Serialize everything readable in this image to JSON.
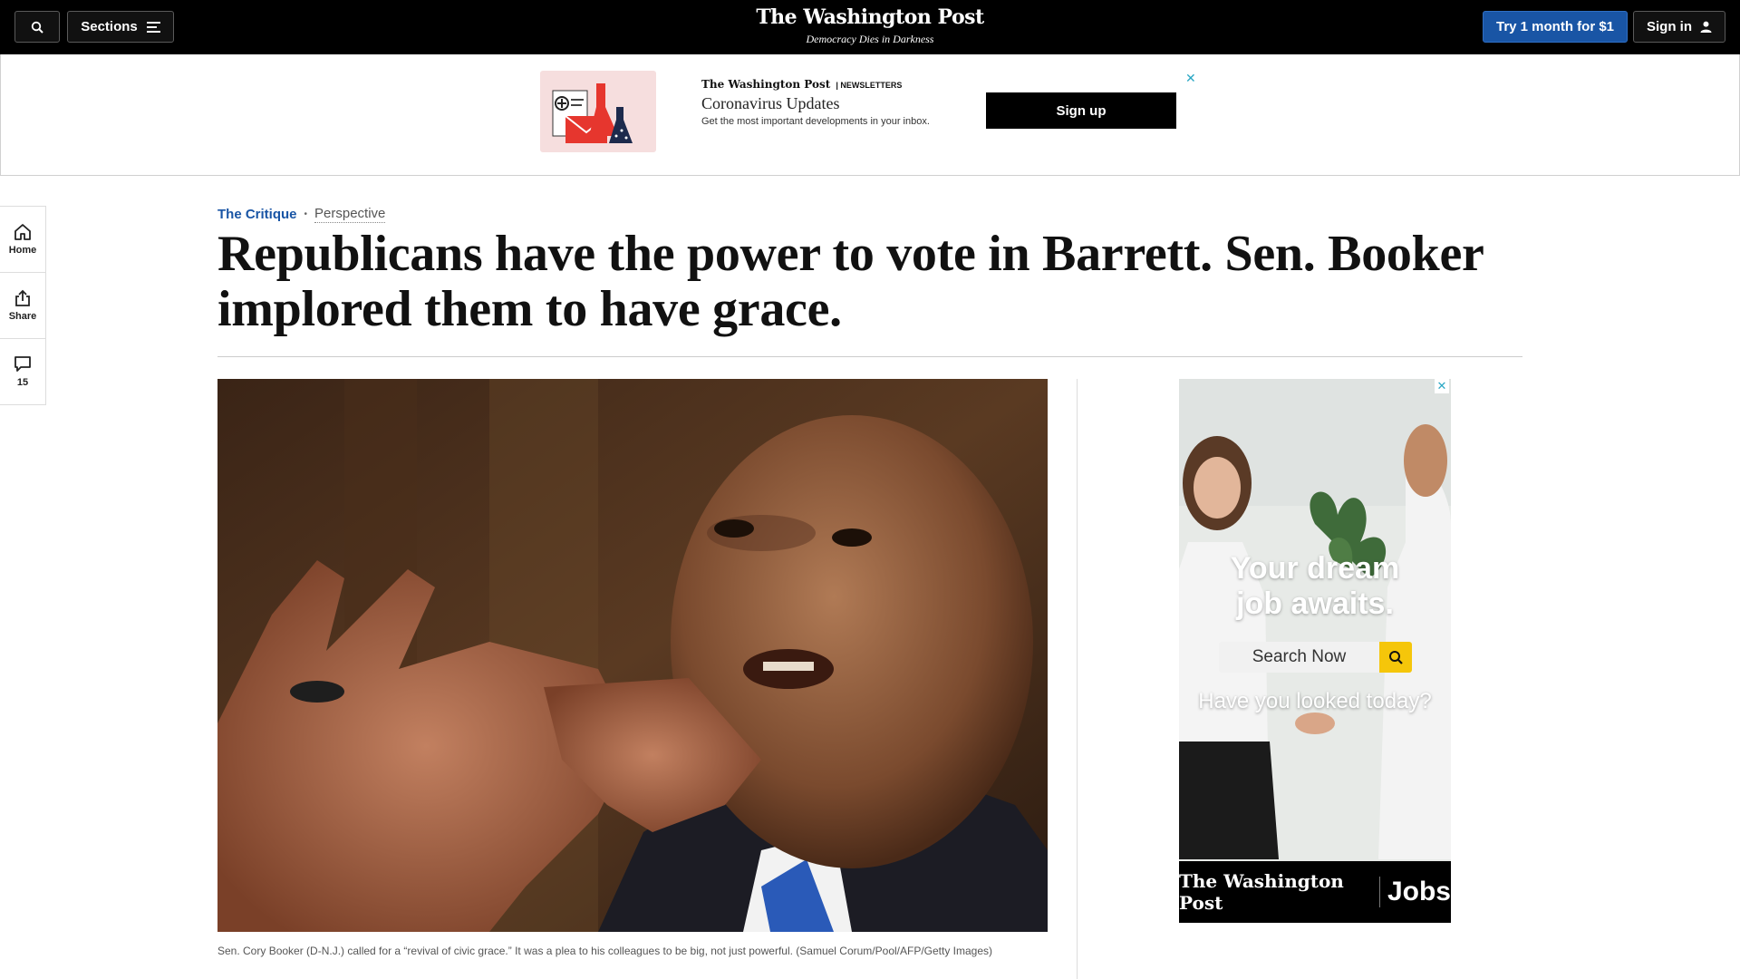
{
  "topbar": {
    "sections_label": "Sections",
    "logo_name": "The Washington Post",
    "logo_tagline": "Democracy Dies in Darkness",
    "trial_label": "Try 1 month for $1",
    "signin_label": "Sign in"
  },
  "newsletter_ad": {
    "brand": "The Washington Post",
    "brand_suffix": "| NEWSLETTERS",
    "title": "Coronavirus Updates",
    "description": "Get the most important developments in your inbox.",
    "signup_label": "Sign up"
  },
  "rail": {
    "home_label": "Home",
    "share_label": "Share",
    "comments_count": "15"
  },
  "article": {
    "section": "The Critique",
    "label": "Perspective",
    "headline": "Republicans have the power to vote in Barrett. Sen. Booker implored them to have grace.",
    "caption": "Sen. Cory Booker (D-N.J.) called for a “revival of civic grace.” It was a plea to his colleagues to be big, not just powerful. (Samuel Corum/Pool/AFP/Getty Images)"
  },
  "jobs_ad": {
    "headline_line1": "Your dream",
    "headline_line2": "job awaits.",
    "search_label": "Search Now",
    "question": "Have you looked today?",
    "footer_brand": "The Washington Post",
    "footer_jobs": "Jobs"
  },
  "colors": {
    "accent_blue": "#1955a5",
    "topbar_bg": "#000000",
    "jobs_yellow": "#f5c60a"
  }
}
